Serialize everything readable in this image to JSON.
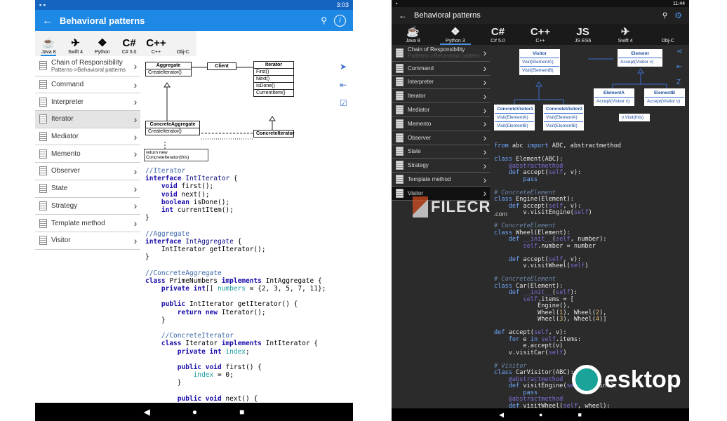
{
  "left": {
    "status_time": "3:03",
    "title": "Behavioral patterns",
    "langs": [
      {
        "icon": "java-icon",
        "glyph": "☕",
        "label": "Java 8"
      },
      {
        "icon": "swift-icon",
        "glyph": "✈",
        "label": "Swift 4"
      },
      {
        "icon": "python-icon",
        "glyph": "❖",
        "label": "Python"
      },
      {
        "icon": "csharp-icon",
        "glyph": "C#",
        "label": "C# 5.0"
      },
      {
        "icon": "cpp-icon",
        "glyph": "C++",
        "label": "C++"
      },
      {
        "icon": "objc-icon",
        "glyph": "",
        "label": "Obj-C"
      }
    ],
    "menu": [
      {
        "label": "Chain of Responsibility",
        "sub": "Patterns->Behavioral patterns"
      },
      {
        "label": "Command"
      },
      {
        "label": "Interpreter"
      },
      {
        "label": "Iterator"
      },
      {
        "label": "Mediator"
      },
      {
        "label": "Memento"
      },
      {
        "label": "Observer"
      },
      {
        "label": "State"
      },
      {
        "label": "Strategy"
      },
      {
        "label": "Template method"
      },
      {
        "label": "Visitor"
      }
    ],
    "uml": {
      "aggregate": {
        "name": "Aggregate",
        "op": "CreateIterator()"
      },
      "client": "Client",
      "iterator": {
        "name": "Iterator",
        "ops": [
          "First()",
          "Next()",
          "IsDone()",
          "CurrentItem()"
        ]
      },
      "concrete_aggregate": {
        "name": "ConcreteAggregate",
        "op": "CreateIterator()"
      },
      "concrete_iterator": "ConcreteIterator",
      "note": "return new ConcreteIterator(this)"
    }
  },
  "right": {
    "status_time": "11:44",
    "title": "Behavioral patterns",
    "langs": [
      {
        "icon": "java-icon",
        "glyph": "☕",
        "label": "Java 8"
      },
      {
        "icon": "python-icon",
        "glyph": "❖",
        "label": "Python 3"
      },
      {
        "icon": "csharp-icon",
        "glyph": "C#",
        "label": "C# 5.0"
      },
      {
        "icon": "cpp-icon",
        "glyph": "C++",
        "label": "C++"
      },
      {
        "icon": "js-icon",
        "glyph": "JS",
        "label": "JS ES6"
      },
      {
        "icon": "swift-icon",
        "glyph": "✈",
        "label": "Swift 4"
      },
      {
        "icon": "objc-icon",
        "glyph": "",
        "label": "Obj-C"
      }
    ],
    "menu": [
      {
        "label": "Chain of Responsibility",
        "sub": "Patterns->Behavioral patterns"
      },
      {
        "label": "Command"
      },
      {
        "label": "Interpreter"
      },
      {
        "label": "Iterator"
      },
      {
        "label": "Mediator"
      },
      {
        "label": "Memento"
      },
      {
        "label": "Observer"
      },
      {
        "label": "State"
      },
      {
        "label": "Strategy"
      },
      {
        "label": "Template method"
      },
      {
        "label": "Visitor"
      }
    ],
    "uml": {
      "visitor": {
        "name": "Visitor",
        "ops": [
          "Visit(ElementA)",
          "Visit(ElementB)"
        ]
      },
      "element": {
        "name": "Element",
        "op": "Accept(Visitor v)"
      },
      "cv1": {
        "name": "ConcreteVisitor1",
        "ops": [
          "Visit(ElementA)",
          "Visit(ElementB)"
        ]
      },
      "cv2": {
        "name": "ConcreteVisitor2",
        "ops": [
          "Visit(ElementA)",
          "Visit(ElementB)"
        ]
      },
      "ea": {
        "name": "ElementA",
        "op": "Accept(Visitor v)"
      },
      "eb": {
        "name": "ElementB",
        "op": "Accept(Visitor v)"
      },
      "note": "v.Visit(this)"
    }
  },
  "watermarks": {
    "filecr": "FILECR",
    "filecr_sub": ".com",
    "desktop": "esktop"
  },
  "colors": {
    "left_bar": "#1e88e5",
    "left_status": "#1565c0",
    "right_bar": "#212121",
    "accent_dark": "#1e88e5"
  }
}
